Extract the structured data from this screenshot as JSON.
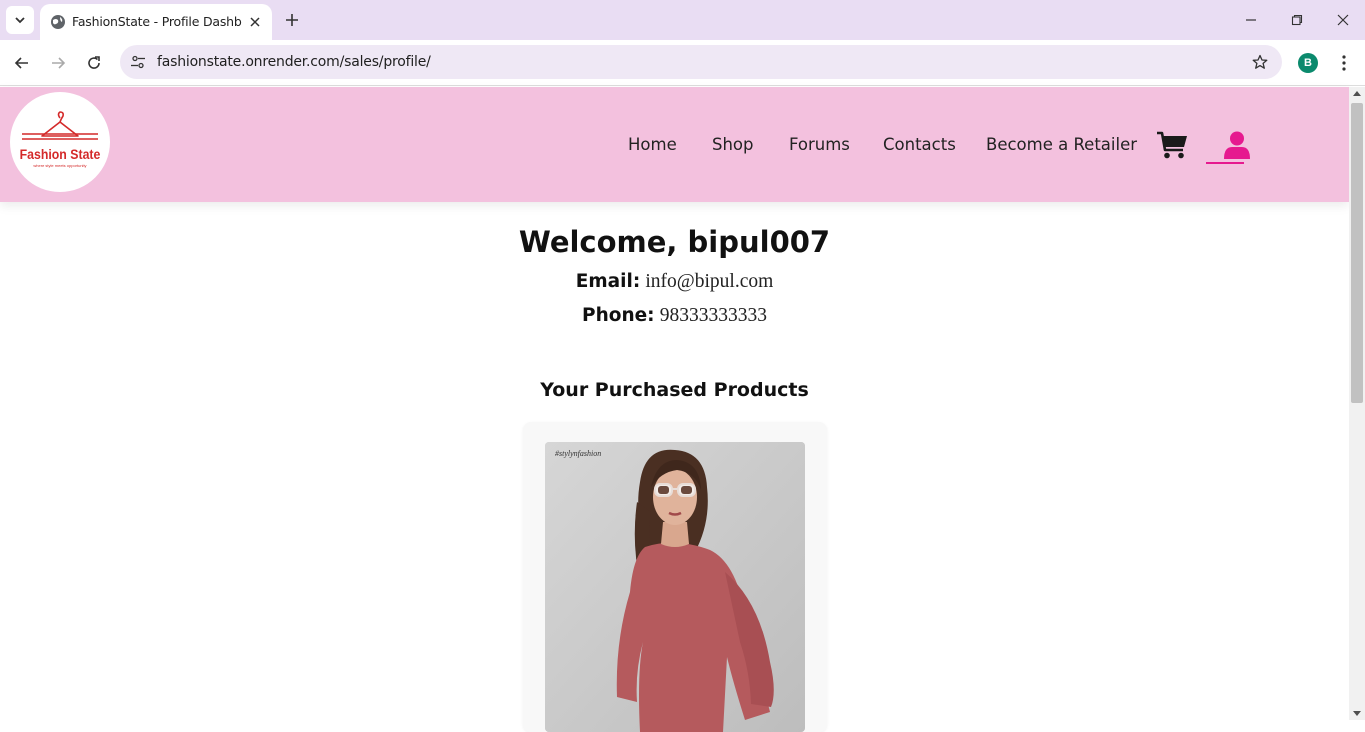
{
  "browser": {
    "tab_title": "FashionState - Profile Dashboard",
    "url": "fashionstate.onrender.com/sales/profile/",
    "profile_initial": "B"
  },
  "site": {
    "logo_title": "Fashion State",
    "logo_tagline": "where style meets opportunity",
    "nav": [
      "Home",
      "Shop",
      "Forums",
      "Contacts",
      "Become a Retailer"
    ],
    "accent_color": "#e6198f",
    "header_color": "#f3c1de"
  },
  "profile": {
    "welcome": "Welcome, bipul007",
    "email_label": "Email:",
    "email": "info@bipul.com",
    "phone_label": "Phone:",
    "phone": "98333333333"
  },
  "purchases": {
    "title": "Your Purchased Products",
    "items": [
      {
        "image_caption": "#stylynfashion"
      }
    ]
  }
}
